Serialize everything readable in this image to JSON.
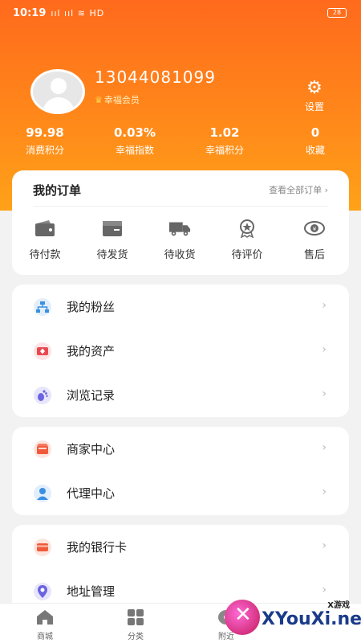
{
  "status_bar": {
    "time": "10:19",
    "signal": "ııl ııl",
    "network": "HD",
    "battery": "28"
  },
  "profile": {
    "phone": "13044081099",
    "member_level": "幸福会员"
  },
  "settings": {
    "label": "设置"
  },
  "stats": [
    {
      "value": "99.98",
      "label": "消费积分"
    },
    {
      "value": "0.03%",
      "label": "幸福指数"
    },
    {
      "value": "1.02",
      "label": "幸福积分"
    },
    {
      "value": "0",
      "label": "收藏"
    }
  ],
  "orders": {
    "title": "我的订单",
    "view_all": "查看全部订单 ›",
    "items": [
      {
        "label": "待付款",
        "icon": "wallet-icon"
      },
      {
        "label": "待发货",
        "icon": "box-icon"
      },
      {
        "label": "待收货",
        "icon": "truck-icon"
      },
      {
        "label": "待评价",
        "icon": "badge-icon"
      },
      {
        "label": "售后",
        "icon": "eye-money-icon"
      }
    ]
  },
  "menu_groups": [
    [
      {
        "label": "我的粉丝",
        "icon": "org-chart-icon",
        "color": "#3b8fe0"
      },
      {
        "label": "我的资产",
        "icon": "diamond-icon",
        "color": "#e8484f"
      },
      {
        "label": "浏览记录",
        "icon": "footprint-icon",
        "color": "#6b63e0"
      }
    ],
    [
      {
        "label": "商家中心",
        "icon": "shop-icon",
        "color": "#f05a3a"
      },
      {
        "label": "代理中心",
        "icon": "agent-icon",
        "color": "#3b8fe0"
      }
    ],
    [
      {
        "label": "我的银行卡",
        "icon": "card-icon",
        "color": "#f05a3a"
      },
      {
        "label": "地址管理",
        "icon": "location-icon",
        "color": "#6b63e0"
      }
    ]
  ],
  "tabbar": [
    {
      "label": "商城",
      "icon": "home-icon"
    },
    {
      "label": "分类",
      "icon": "grid-icon"
    },
    {
      "label": "附近",
      "icon": "nearby-icon"
    }
  ],
  "watermark": {
    "brand_cn": "X游戏",
    "brand_en": "XYouXi.net"
  }
}
